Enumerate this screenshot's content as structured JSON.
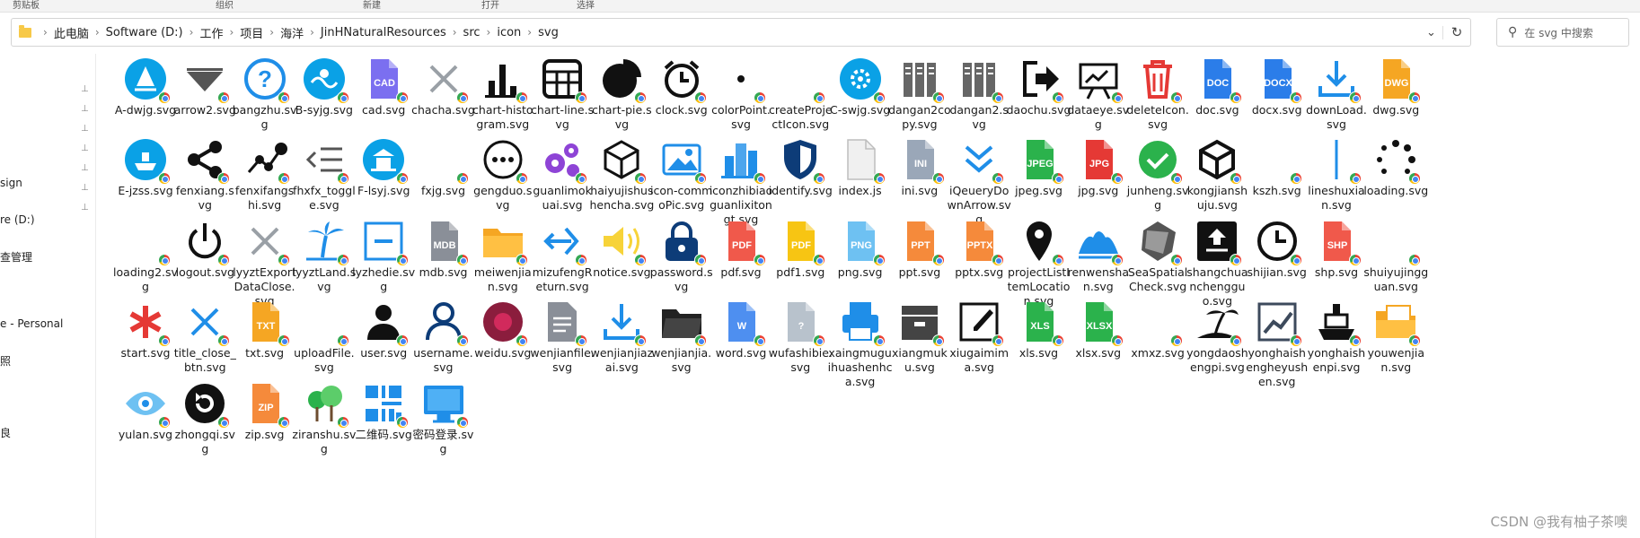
{
  "ribbon": {
    "clipboard": "剪贴板",
    "organize": "组织",
    "new": "新建",
    "open": "打开",
    "select": "选择"
  },
  "address": {
    "crumbs": [
      "此电脑",
      "Software (D:)",
      "工作",
      "项目",
      "海洋",
      "JinHNaturalResources",
      "src",
      "icon",
      "svg"
    ]
  },
  "search": {
    "placeholder": "在 svg 中搜索"
  },
  "nav": {
    "items": [
      "sign",
      "re (D:)",
      "查管理",
      "",
      "e - Personal",
      "照",
      "",
      "良"
    ]
  },
  "watermark": "CSDN @我有柚子茶噢",
  "files": [
    {
      "name": "A-dwjg.svg",
      "icon": "circle-cyan-sail-icon",
      "color": "#0aa1e6"
    },
    {
      "name": "arrow2.svg",
      "icon": "triangle-down-icon",
      "color": "#555555"
    },
    {
      "name": "bangzhu.svg",
      "icon": "help-circle-icon",
      "color": "#1f8ee8"
    },
    {
      "name": "B-syjg.svg",
      "icon": "circle-cyan-wave-icon",
      "color": "#0aa1e6"
    },
    {
      "name": "cad.svg",
      "icon": "cad-file-icon",
      "color": "#7b6ff0"
    },
    {
      "name": "chacha.svg",
      "icon": "close-x-icon",
      "color": "#9aa0a6"
    },
    {
      "name": "chart-histogram.svg",
      "icon": "bar-chart-icon",
      "color": "#111111"
    },
    {
      "name": "chart-line.svg",
      "icon": "table-grid-icon",
      "color": "#111111"
    },
    {
      "name": "chart-pie.svg",
      "icon": "pie-chart-icon",
      "color": "#111111"
    },
    {
      "name": "clock.svg",
      "icon": "alarm-clock-icon",
      "color": "#111111"
    },
    {
      "name": "colorPoint.svg",
      "icon": "dot-icon",
      "color": "#111111"
    },
    {
      "name": "createProjectIcon.svg",
      "icon": "blank-icon",
      "color": "#ffffff"
    },
    {
      "name": "C-swjg.svg",
      "icon": "circle-cyan-gear-icon",
      "color": "#0aa1e6"
    },
    {
      "name": "dangan2copy.svg",
      "icon": "binders-icon",
      "color": "#666666"
    },
    {
      "name": "dangan2.svg",
      "icon": "binders-icon",
      "color": "#666666"
    },
    {
      "name": "daochu.svg",
      "icon": "export-arrow-icon",
      "color": "#111111"
    },
    {
      "name": "dataeye.svg",
      "icon": "presentation-board-icon",
      "color": "#111111"
    },
    {
      "name": "deleteIcon.svg",
      "icon": "trash-icon",
      "color": "#e53935"
    },
    {
      "name": "doc.svg",
      "icon": "doc-file-icon",
      "color": "#2b7de9"
    },
    {
      "name": "docx.svg",
      "icon": "docx-file-icon",
      "color": "#2b7de9"
    },
    {
      "name": "downLoad.svg",
      "icon": "download-tray-icon",
      "color": "#1f8ee8"
    },
    {
      "name": "dwg.svg",
      "icon": "dwg-file-icon",
      "color": "#f5a623"
    },
    {
      "name": "E-jzss.svg",
      "icon": "circle-cyan-ship-icon",
      "color": "#0aa1e6"
    },
    {
      "name": "fenxiang.svg",
      "icon": "share-nodes-icon",
      "color": "#111111"
    },
    {
      "name": "fenxifangshi.svg",
      "icon": "line-nodes-icon",
      "color": "#111111"
    },
    {
      "name": "fhxfx_toggle.svg",
      "icon": "toggle-lines-icon",
      "color": "#555555"
    },
    {
      "name": "F-lsyj.svg",
      "icon": "circle-cyan-pagoda-icon",
      "color": "#0aa1e6"
    },
    {
      "name": "fxjg.svg",
      "icon": "blank-icon",
      "color": "#ffffff"
    },
    {
      "name": "gengduo.svg",
      "icon": "more-dots-icon",
      "color": "#111111"
    },
    {
      "name": "guanlimokuai.svg",
      "icon": "gears-icon",
      "color": "#8e44d6"
    },
    {
      "name": "haiyujishushencha.svg",
      "icon": "cube-outline-icon",
      "color": "#111111"
    },
    {
      "name": "icon-commoPic.svg",
      "icon": "picture-icon",
      "color": "#1f8ee8"
    },
    {
      "name": "iconzhibiaoguanlixitongt.svg",
      "icon": "buildings-icon",
      "color": "#1f8ee8"
    },
    {
      "name": "identify.svg",
      "icon": "shield-icon",
      "color": "#0d3c78"
    },
    {
      "name": "index.js",
      "icon": "blank-file-icon",
      "color": "#dddddd"
    },
    {
      "name": "ini.svg",
      "icon": "ini-file-icon",
      "color": "#9aa7b8"
    },
    {
      "name": "iQeueryDownArrow.svg",
      "icon": "double-chevron-icon",
      "color": "#1f8ee8"
    },
    {
      "name": "jpeg.svg",
      "icon": "jpeg-file-icon",
      "color": "#2bb24c"
    },
    {
      "name": "jpg.svg",
      "icon": "jpg-file-icon",
      "color": "#e53935"
    },
    {
      "name": "junheng.svg",
      "icon": "check-circle-icon",
      "color": "#2bb24c"
    },
    {
      "name": "kongjianshuju.svg",
      "icon": "cube-icon",
      "color": "#111111"
    },
    {
      "name": "kszh.svg",
      "icon": "blank-icon",
      "color": "#ffffff"
    },
    {
      "name": "lineshuxian.svg",
      "icon": "vertical-line-icon",
      "color": "#1f8ee8"
    },
    {
      "name": "loading.svg",
      "icon": "loading-dots-icon",
      "color": "#111111"
    },
    {
      "name": "loading2.svg",
      "icon": "blank-icon",
      "color": "#ffffff"
    },
    {
      "name": "logout.svg",
      "icon": "power-icon",
      "color": "#111111"
    },
    {
      "name": "lyyztExportDataClose.svg",
      "icon": "close-x-icon",
      "color": "#9aa0a6"
    },
    {
      "name": "lyyztLand.svg",
      "icon": "palm-icon",
      "color": "#1f8ee8"
    },
    {
      "name": "lyzhedie.svg",
      "icon": "collapse-box-icon",
      "color": "#1f8ee8"
    },
    {
      "name": "mdb.svg",
      "icon": "mdb-file-icon",
      "color": "#8a8f98"
    },
    {
      "name": "meiwenjian.svg",
      "icon": "folder-orange-icon",
      "color": "#f5a623"
    },
    {
      "name": "mizufengReturn.svg",
      "icon": "wind-icon",
      "color": "#1f8ee8"
    },
    {
      "name": "notice.svg",
      "icon": "speaker-icon",
      "color": "#f7d339"
    },
    {
      "name": "password.svg",
      "icon": "padlock-icon",
      "color": "#0d3c78"
    },
    {
      "name": "pdf.svg",
      "icon": "pdf-file-icon",
      "color": "#f0594b"
    },
    {
      "name": "pdf1.svg",
      "icon": "pdf-yellow-icon",
      "color": "#f7c513"
    },
    {
      "name": "png.svg",
      "icon": "png-file-icon",
      "color": "#6ec1f2"
    },
    {
      "name": "ppt.svg",
      "icon": "ppt-file-icon",
      "color": "#f58a3b"
    },
    {
      "name": "pptx.svg",
      "icon": "pptx-file-icon",
      "color": "#f58a3b"
    },
    {
      "name": "projectListItemLocation.svg",
      "icon": "map-pin-icon",
      "color": "#111111"
    },
    {
      "name": "renwenshan.svg",
      "icon": "mountain-icon",
      "color": "#1f8ee8"
    },
    {
      "name": "SeaSpatialCheck.svg",
      "icon": "polygon-shape-icon",
      "color": "#555555"
    },
    {
      "name": "shangchuanchengguo.svg",
      "icon": "upload-box-icon",
      "color": "#111111"
    },
    {
      "name": "shijian.svg",
      "icon": "clock-icon",
      "color": "#111111"
    },
    {
      "name": "shp.svg",
      "icon": "shp-file-icon",
      "color": "#f0594b"
    },
    {
      "name": "shuiyujingguan.svg",
      "icon": "blank-icon",
      "color": "#ffffff"
    },
    {
      "name": "start.svg",
      "icon": "asterisk-icon",
      "color": "#e53935"
    },
    {
      "name": "title_close_btn.svg",
      "icon": "close-x-icon",
      "color": "#1f8ee8"
    },
    {
      "name": "txt.svg",
      "icon": "txt-file-icon",
      "color": "#f5a623"
    },
    {
      "name": "uploadFile.svg",
      "icon": "blank-icon",
      "color": "#ffffff"
    },
    {
      "name": "user.svg",
      "icon": "user-icon",
      "color": "#111111"
    },
    {
      "name": "username.svg",
      "icon": "user-outline-icon",
      "color": "#0d3c78"
    },
    {
      "name": "weidu.svg",
      "icon": "target-circle-icon",
      "color": "#8b1d3d"
    },
    {
      "name": "wenjianfile.svg",
      "icon": "document-grey-icon",
      "color": "#8a8f98"
    },
    {
      "name": "wenjianjiazai.svg",
      "icon": "download-tray-icon",
      "color": "#1f8ee8"
    },
    {
      "name": "wenjianjia.svg",
      "icon": "folder-dark-icon",
      "color": "#222222"
    },
    {
      "name": "word.svg",
      "icon": "word-file-icon",
      "color": "#4e8ff0"
    },
    {
      "name": "wufashibie.svg",
      "icon": "question-file-icon",
      "color": "#b8c2cc"
    },
    {
      "name": "xaingmuguihuashenhca.svg",
      "icon": "printer-icon",
      "color": "#1f8ee8"
    },
    {
      "name": "xiangmuku.svg",
      "icon": "library-box-icon",
      "color": "#444444"
    },
    {
      "name": "xiugaimima.svg",
      "icon": "edit-icon",
      "color": "#111111"
    },
    {
      "name": "xls.svg",
      "icon": "xls-file-icon",
      "color": "#2bb24c"
    },
    {
      "name": "xlsx.svg",
      "icon": "xlsx-file-icon",
      "color": "#2bb24c"
    },
    {
      "name": "xmxz.svg",
      "icon": "blank-icon",
      "color": "#ffffff"
    },
    {
      "name": "yongdaoshengpi.svg",
      "icon": "island-icon",
      "color": "#111111"
    },
    {
      "name": "yonghaishengheyushen.svg",
      "icon": "chart-box-icon",
      "color": "#3d4a5c"
    },
    {
      "name": "yonghaishenpi.svg",
      "icon": "ship-icon",
      "color": "#111111"
    },
    {
      "name": "youwenjian.svg",
      "icon": "folder-docs-icon",
      "color": "#f5a623"
    },
    {
      "name": "yulan.svg",
      "icon": "eye-icon",
      "color": "#6ec1f2"
    },
    {
      "name": "zhongqi.svg",
      "icon": "restart-circle-icon",
      "color": "#111111"
    },
    {
      "name": "zip.svg",
      "icon": "zip-file-icon",
      "color": "#f58a3b"
    },
    {
      "name": "ziranshu.svg",
      "icon": "trees-icon",
      "color": "#2bb24c"
    },
    {
      "name": "二维码.svg",
      "icon": "qr-code-icon",
      "color": "#1f8ee8"
    },
    {
      "name": "密码登录.svg",
      "icon": "monitor-icon",
      "color": "#1f8ee8"
    }
  ]
}
